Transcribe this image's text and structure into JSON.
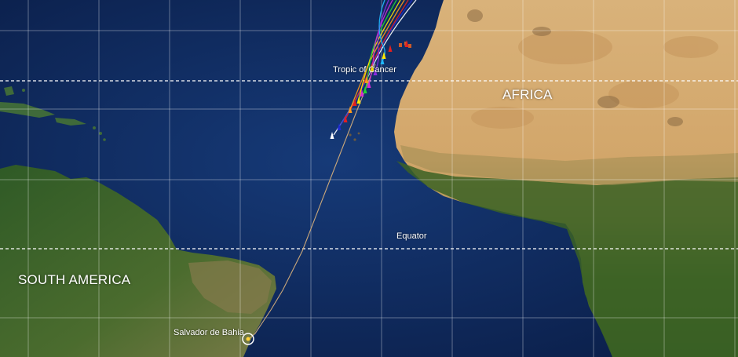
{
  "map": {
    "labels": {
      "tropic_of_cancer": "Tropic of Cancer",
      "equator": "Equator",
      "africa": "AFRICA",
      "south_america": "SOUTH AMERICA",
      "destination": "Salvador de Bahia"
    },
    "colors": {
      "ocean": "#0d2350",
      "desert": "#d6ab6c",
      "vegetation": "#3d6224",
      "grid": "#ffffff",
      "route": "#c9a77a"
    },
    "boat_colors": [
      "#ffffff",
      "#1e2bd1",
      "#e32020",
      "#ff9a1a",
      "#ffe800",
      "#22d433",
      "#d62ad6",
      "#8a2be2",
      "#1fb8ff"
    ],
    "destination_marker_icon": "target-circle-icon"
  }
}
